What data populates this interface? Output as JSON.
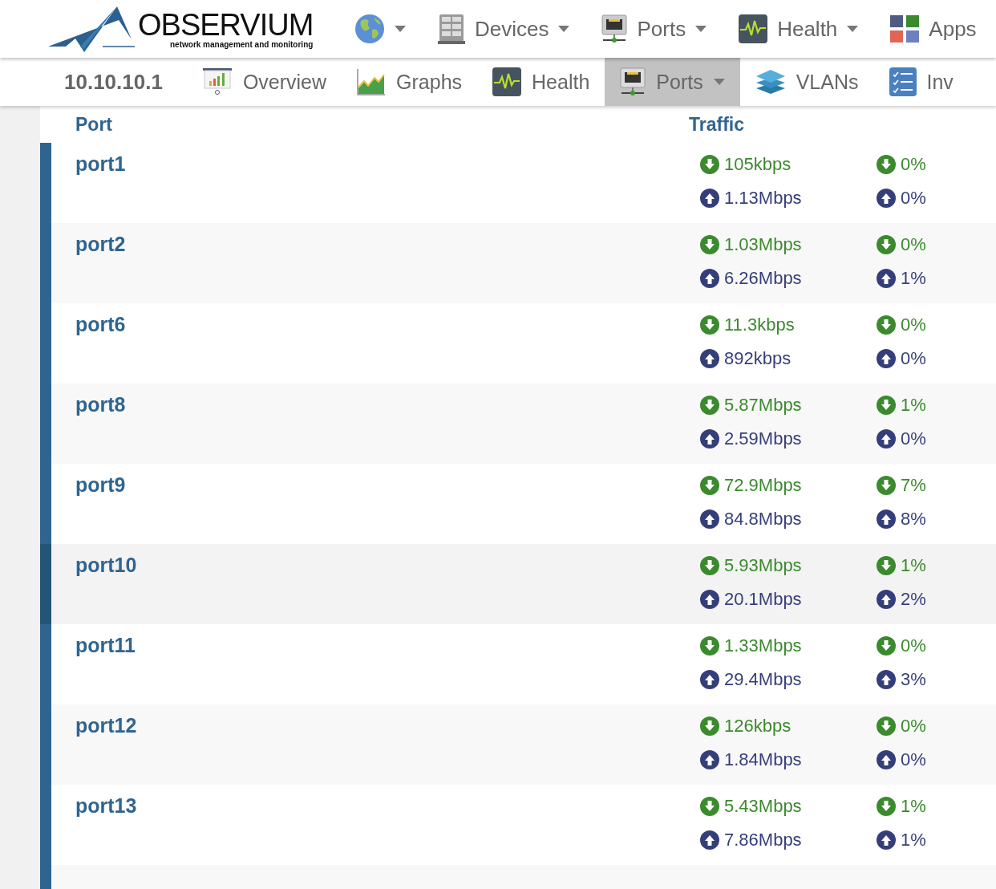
{
  "logo": {
    "name": "OBSERVIUM",
    "tagline": "network management and monitoring"
  },
  "top_nav": [
    {
      "kind": "globe",
      "dropdown": true
    },
    {
      "kind": "server",
      "label": "Devices",
      "dropdown": true
    },
    {
      "kind": "port",
      "label": "Ports",
      "dropdown": true
    },
    {
      "kind": "pulse",
      "label": "Health",
      "dropdown": true
    },
    {
      "kind": "apps",
      "label": "Apps",
      "dropdown": false
    }
  ],
  "device_nav": {
    "device": "10.10.10.1",
    "tabs": [
      {
        "kind": "presentation",
        "label": "Overview",
        "selected": false,
        "dropdown": false
      },
      {
        "kind": "area",
        "label": "Graphs",
        "selected": false,
        "dropdown": false
      },
      {
        "kind": "pulse",
        "label": "Health",
        "selected": false,
        "dropdown": false
      },
      {
        "kind": "port",
        "label": "Ports",
        "selected": true,
        "dropdown": true
      },
      {
        "kind": "layers",
        "label": "VLANs",
        "selected": false,
        "dropdown": false
      },
      {
        "kind": "checklist",
        "label": "Inv",
        "selected": false,
        "dropdown": false
      }
    ]
  },
  "table": {
    "columns": [
      "Port",
      "Traffic"
    ],
    "rows": [
      {
        "port": "port1",
        "in_rate": "105kbps",
        "in_pct": "0%",
        "out_rate": "1.13Mbps",
        "out_pct": "0%",
        "highlighted": false
      },
      {
        "port": "port2",
        "in_rate": "1.03Mbps",
        "in_pct": "0%",
        "out_rate": "6.26Mbps",
        "out_pct": "1%",
        "highlighted": false
      },
      {
        "port": "port6",
        "in_rate": "11.3kbps",
        "in_pct": "0%",
        "out_rate": "892kbps",
        "out_pct": "0%",
        "highlighted": false
      },
      {
        "port": "port8",
        "in_rate": "5.87Mbps",
        "in_pct": "1%",
        "out_rate": "2.59Mbps",
        "out_pct": "0%",
        "highlighted": false
      },
      {
        "port": "port9",
        "in_rate": "72.9Mbps",
        "in_pct": "7%",
        "out_rate": "84.8Mbps",
        "out_pct": "8%",
        "highlighted": false
      },
      {
        "port": "port10",
        "in_rate": "5.93Mbps",
        "in_pct": "1%",
        "out_rate": "20.1Mbps",
        "out_pct": "2%",
        "highlighted": true
      },
      {
        "port": "port11",
        "in_rate": "1.33Mbps",
        "in_pct": "0%",
        "out_rate": "29.4Mbps",
        "out_pct": "3%",
        "highlighted": false
      },
      {
        "port": "port12",
        "in_rate": "126kbps",
        "in_pct": "0%",
        "out_rate": "1.84Mbps",
        "out_pct": "0%",
        "highlighted": false
      },
      {
        "port": "port13",
        "in_rate": "5.43Mbps",
        "in_pct": "1%",
        "out_rate": "7.86Mbps",
        "out_pct": "1%",
        "highlighted": false
      }
    ]
  }
}
